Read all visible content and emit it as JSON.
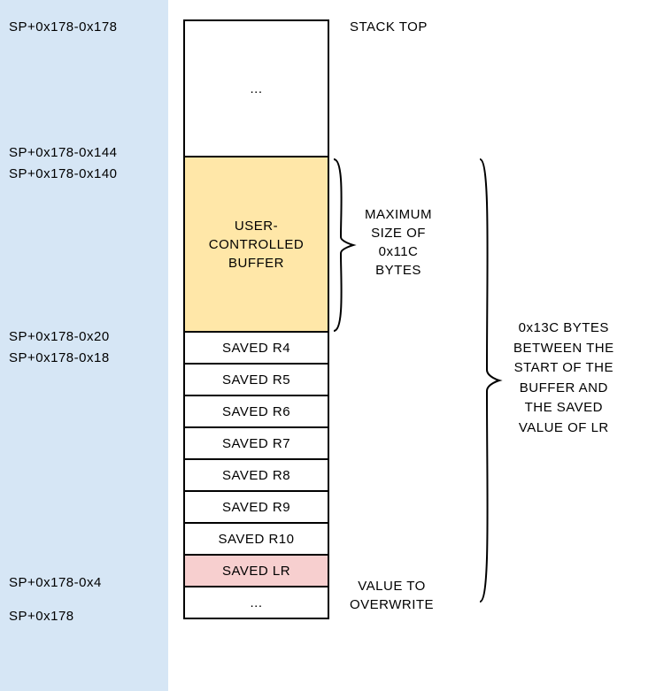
{
  "addresses": {
    "a0": "SP+0x178-0x178",
    "a1": "SP+0x178-0x144",
    "a2": "SP+0x178-0x140",
    "a3": "SP+0x178-0x20",
    "a4": "SP+0x178-0x18",
    "a5": "SP+0x178-0x4",
    "a6": "SP+0x178"
  },
  "cells": {
    "top_ellipsis": "...",
    "buffer_line1": "USER-",
    "buffer_line2": "CONTROLLED",
    "buffer_line3": "BUFFER",
    "r4": "SAVED R4",
    "r5": "SAVED R5",
    "r6": "SAVED R6",
    "r7": "SAVED R7",
    "r8": "SAVED R8",
    "r9": "SAVED R9",
    "r10": "SAVED R10",
    "lr": "SAVED LR",
    "bottom_ellipsis": "..."
  },
  "annotations": {
    "stack_top": "STACK TOP",
    "max_size_l1": "MAXIMUM",
    "max_size_l2": "SIZE OF",
    "max_size_l3": "0x11C",
    "max_size_l4": "BYTES",
    "overwrite_l1": "VALUE TO",
    "overwrite_l2": "OVERWRITE",
    "dist_l1": "0x13C BYTES",
    "dist_l2": "BETWEEN THE",
    "dist_l3": "START OF THE",
    "dist_l4": "BUFFER AND",
    "dist_l5": "THE SAVED",
    "dist_l6": "VALUE OF LR"
  }
}
